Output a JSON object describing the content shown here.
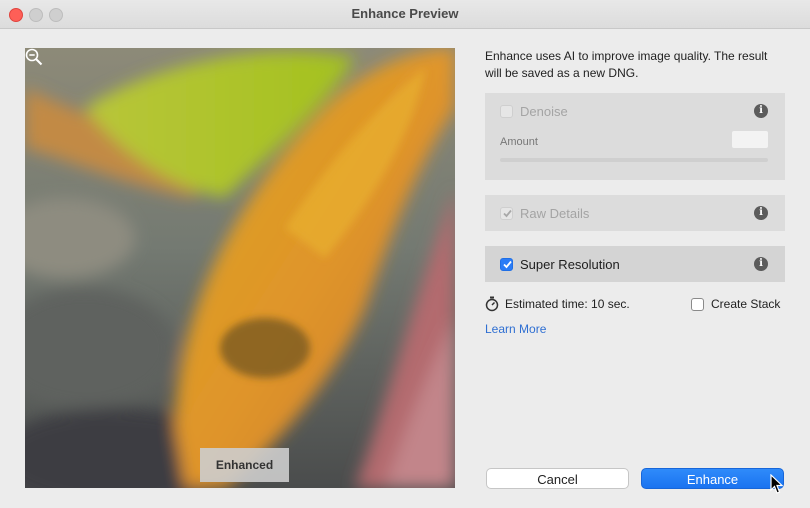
{
  "window": {
    "title": "Enhance Preview"
  },
  "preview": {
    "overlay_label": "Enhanced",
    "zoom_icon": "zoom-out-icon"
  },
  "description": "Enhance uses AI to improve image quality. The result will be saved as a new DNG.",
  "options": {
    "denoise": {
      "label": "Denoise",
      "checked": false,
      "enabled": false,
      "amount_label": "Amount",
      "amount_value": ""
    },
    "raw_details": {
      "label": "Raw Details",
      "checked": true,
      "enabled": false
    },
    "super_resolution": {
      "label": "Super Resolution",
      "checked": true,
      "enabled": true
    }
  },
  "info_glyph": "i",
  "estimate": {
    "text": "Estimated time: 10 sec.",
    "icon": "stopwatch-icon"
  },
  "create_stack": {
    "label": "Create Stack",
    "checked": false
  },
  "learn_more": "Learn More",
  "buttons": {
    "cancel": "Cancel",
    "enhance": "Enhance"
  },
  "colors": {
    "accent": "#2b7cf6",
    "link": "#2f6fd2",
    "close": "#fe5f57"
  }
}
